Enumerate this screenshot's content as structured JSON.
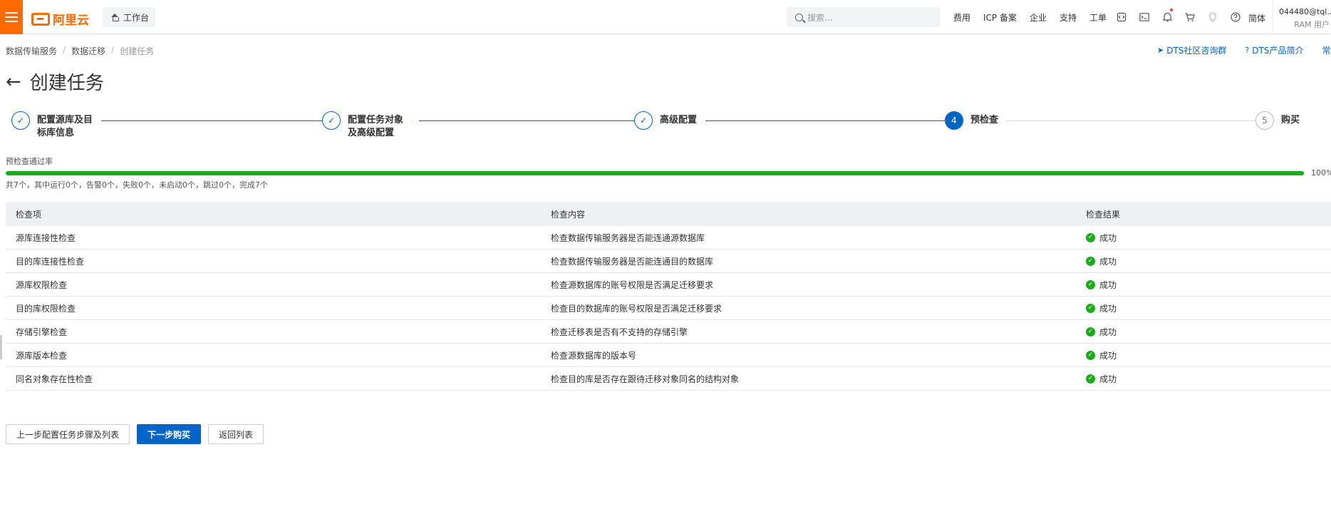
{
  "topbar": {
    "logo_text": "阿里云",
    "workspace_label": "工作台",
    "search_placeholder": "搜索...",
    "links": [
      "费用",
      "ICP 备案",
      "企业",
      "支持",
      "工单"
    ],
    "icons": [
      "code-icon",
      "terminal-icon",
      "bell-icon",
      "cart-icon",
      "bulb-icon",
      "help-icon"
    ],
    "language": "简体",
    "user_id": "044480@tql...",
    "user_role": "RAM 用户"
  },
  "breadcrumb": [
    "数据传输服务",
    "数据迁移",
    "创建任务"
  ],
  "top_links": [
    "DTS社区咨询群",
    "DTS产品简介",
    "常见问题"
  ],
  "page_title": "创建任务",
  "steps": [
    {
      "label": "配置源库及目标库信息",
      "status": "done"
    },
    {
      "label": "配置任务对象及高级配置",
      "status": "done"
    },
    {
      "label": "高级配置",
      "status": "done"
    },
    {
      "label": "预检查",
      "number": "4",
      "status": "active"
    },
    {
      "label": "购买",
      "number": "5",
      "status": "pending"
    }
  ],
  "precheck": {
    "label": "预检查通过率",
    "percent": 100,
    "percent_text": "100%",
    "summary": "共7个，其中运行0个，告警0个，失败0个，未启动0个，跳过0个，完成7个"
  },
  "table": {
    "headers": [
      "检查项",
      "检查内容",
      "检查结果"
    ],
    "rows": [
      {
        "item": "源库连接性检查",
        "content": "检查数据传输服务器是否能连通源数据库",
        "result": "成功"
      },
      {
        "item": "目的库连接性检查",
        "content": "检查数据传输服务器是否能连通目的数据库",
        "result": "成功"
      },
      {
        "item": "源库权限检查",
        "content": "检查源数据库的账号权限是否满足迁移要求",
        "result": "成功"
      },
      {
        "item": "目的库权限检查",
        "content": "检查目的数据库的账号权限是否满足迁移要求",
        "result": "成功"
      },
      {
        "item": "存储引擎检查",
        "content": "检查迁移表是否有不支持的存储引擎",
        "result": "成功"
      },
      {
        "item": "源库版本检查",
        "content": "检查源数据库的版本号",
        "result": "成功"
      },
      {
        "item": "同名对象存在性检查",
        "content": "检查目的库是否存在跟待迁移对象同名的结构对象",
        "result": "成功"
      }
    ]
  },
  "buttons": {
    "prev": "上一步配置任务步骤及列表",
    "next": "下一步购买",
    "back": "返回列表"
  },
  "colors": {
    "accent": "#0064c8",
    "brand": "#ff6a00",
    "success": "#1aad19"
  }
}
